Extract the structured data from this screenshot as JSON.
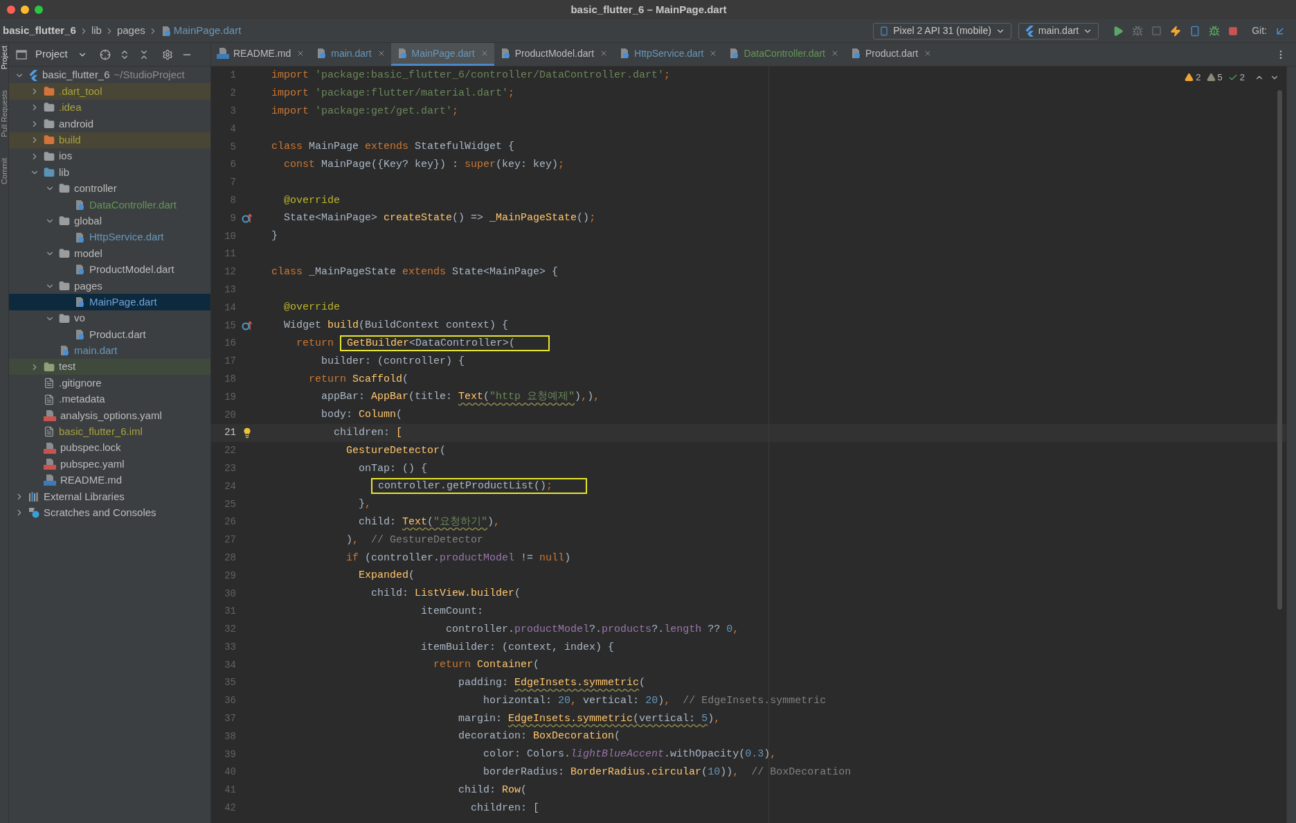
{
  "window": {
    "title": "basic_flutter_6 – MainPage.dart"
  },
  "breadcrumb": [
    "basic_flutter_6",
    "lib",
    "pages",
    "MainPage.dart"
  ],
  "toolbar": {
    "device": "Pixel 2 API 31 (mobile)",
    "run_config": "main.dart",
    "git_label": "Git:"
  },
  "tool_strip": [
    "Project",
    "Pull Requests",
    "Commit"
  ],
  "project_panel": {
    "title": "Project"
  },
  "tree": [
    {
      "name": "basic_flutter_6",
      "note": "~/StudioProject",
      "kind": "flutter",
      "color": "#bbbbbb",
      "expanded": true,
      "children": [
        {
          "name": ".dart_tool",
          "kind": "folder-excluded",
          "color": "#a8a23c",
          "excluded": true,
          "expanded": false
        },
        {
          "name": ".idea",
          "kind": "folder-config",
          "color": "#a8a23c",
          "expanded": false
        },
        {
          "name": "android",
          "kind": "folder-module",
          "color": "#bbbbbb",
          "expanded": false
        },
        {
          "name": "build",
          "kind": "folder-excluded",
          "color": "#a8a23c",
          "excluded": true,
          "expanded": false
        },
        {
          "name": "ios",
          "kind": "folder-module",
          "color": "#bbbbbb",
          "expanded": false
        },
        {
          "name": "lib",
          "kind": "folder-source",
          "color": "#bbbbbb",
          "expanded": true,
          "children": [
            {
              "name": "controller",
              "kind": "folder",
              "color": "#bbbbbb",
              "expanded": true,
              "children": [
                {
                  "name": "DataController.dart",
                  "kind": "dart",
                  "color": "#629755",
                  "selected": false
                }
              ]
            },
            {
              "name": "global",
              "kind": "folder",
              "color": "#bbbbbb",
              "expanded": true,
              "children": [
                {
                  "name": "HttpService.dart",
                  "kind": "dart",
                  "color": "#6897bb",
                  "selected": false
                }
              ]
            },
            {
              "name": "model",
              "kind": "folder",
              "color": "#bbbbbb",
              "expanded": true,
              "children": [
                {
                  "name": "ProductModel.dart",
                  "kind": "dart",
                  "color": "#bbbbbb",
                  "selected": false
                }
              ]
            },
            {
              "name": "pages",
              "kind": "folder",
              "color": "#bbbbbb",
              "expanded": true,
              "children": [
                {
                  "name": "MainPage.dart",
                  "kind": "dart",
                  "selected": true
                }
              ]
            },
            {
              "name": "vo",
              "kind": "folder",
              "color": "#bbbbbb",
              "expanded": true,
              "children": [
                {
                  "name": "Product.dart",
                  "kind": "dart",
                  "color": "#bbbbbb",
                  "selected": false
                }
              ]
            },
            {
              "name": "main.dart",
              "kind": "dart",
              "color": "#6897bb",
              "selected": false
            }
          ]
        },
        {
          "name": "test",
          "kind": "folder-test",
          "color": "#bbbbbb",
          "test_sources": true,
          "expanded": false
        },
        {
          "name": ".gitignore",
          "kind": "file",
          "color": "#bbbbbb"
        },
        {
          "name": ".metadata",
          "kind": "file",
          "color": "#bbbbbb"
        },
        {
          "name": "analysis_options.yaml",
          "kind": "yaml",
          "color": "#bbbbbb"
        },
        {
          "name": "basic_flutter_6.iml",
          "kind": "file",
          "color": "#a8a23c"
        },
        {
          "name": "pubspec.lock",
          "kind": "yaml",
          "color": "#bbbbbb"
        },
        {
          "name": "pubspec.yaml",
          "kind": "yaml",
          "color": "#bbbbbb"
        },
        {
          "name": "README.md",
          "kind": "md",
          "color": "#bbbbbb"
        }
      ]
    },
    {
      "name": "External Libraries",
      "kind": "library",
      "color": "#bbbbbb",
      "expanded": false
    },
    {
      "name": "Scratches and Consoles",
      "kind": "scratches",
      "color": "#bbbbbb",
      "expanded": false
    }
  ],
  "tabs": [
    {
      "label": "README.md",
      "kind": "md",
      "color": "#bbbbbb",
      "selected": false
    },
    {
      "label": "main.dart",
      "kind": "dart",
      "color": "#6897bb",
      "selected": false
    },
    {
      "label": "MainPage.dart",
      "kind": "dart",
      "color": "#6897bb",
      "selected": true
    },
    {
      "label": "ProductModel.dart",
      "kind": "dart",
      "color": "#bbbbbb",
      "selected": false
    },
    {
      "label": "HttpService.dart",
      "kind": "dart",
      "color": "#6897bb",
      "selected": false
    },
    {
      "label": "DataController.dart",
      "kind": "dart",
      "color": "#629755",
      "selected": false
    },
    {
      "label": "Product.dart",
      "kind": "dart",
      "color": "#bbbbbb",
      "selected": false
    }
  ],
  "inspections": [
    {
      "kind": "warning",
      "count": "2"
    },
    {
      "kind": "weak",
      "count": "5"
    },
    {
      "kind": "typo",
      "count": "2"
    }
  ],
  "code_lines": [
    {
      "number": "1",
      "current": false,
      "tokens": [
        {
          "text": "import ",
          "kind": "kw"
        },
        {
          "text": "'package:basic_flutter_6/controller/DataController.dart'",
          "kind": "str"
        },
        {
          "text": ";",
          "kind": "kw"
        }
      ]
    },
    {
      "number": "2",
      "current": false,
      "tokens": [
        {
          "text": "import ",
          "kind": "kw"
        },
        {
          "text": "'package:flutter/material.dart'",
          "kind": "str"
        },
        {
          "text": ";",
          "kind": "kw"
        }
      ]
    },
    {
      "number": "3",
      "current": false,
      "tokens": [
        {
          "text": "import ",
          "kind": "kw"
        },
        {
          "text": "'package:get/get.dart'",
          "kind": "str"
        },
        {
          "text": ";",
          "kind": "kw"
        }
      ]
    },
    {
      "number": "4",
      "current": false
    },
    {
      "number": "5",
      "current": false,
      "tokens": [
        {
          "text": "class ",
          "kind": "kw"
        },
        {
          "text": "MainPage ",
          "kind": "txt"
        },
        {
          "text": "extends ",
          "kind": "kw"
        },
        {
          "text": "StatefulWidget {",
          "kind": "txt"
        }
      ]
    },
    {
      "number": "6",
      "current": false,
      "tokens": [
        {
          "text": "  const ",
          "kind": "kw"
        },
        {
          "text": "MainPage({Key? key}) : ",
          "kind": "txt"
        },
        {
          "text": "super",
          "kind": "kw"
        },
        {
          "text": "(key: key)",
          "kind": "txt"
        },
        {
          "text": ";",
          "kind": "kw"
        }
      ]
    },
    {
      "number": "7",
      "current": false
    },
    {
      "number": "8",
      "current": false,
      "tokens": [
        {
          "text": "  @override",
          "kind": "ann"
        }
      ]
    },
    {
      "number": "9",
      "current": false,
      "kind": "override",
      "tokens": [
        {
          "text": "  State<MainPage> ",
          "kind": "txt"
        },
        {
          "text": "createState",
          "kind": "fn"
        },
        {
          "text": "() => ",
          "kind": "txt"
        },
        {
          "text": "_MainPageState",
          "kind": "fn"
        },
        {
          "text": "()",
          "kind": "txt"
        },
        {
          "text": ";",
          "kind": "kw"
        }
      ]
    },
    {
      "number": "10",
      "current": false,
      "tokens": [
        {
          "text": "}",
          "kind": "txt"
        }
      ]
    },
    {
      "number": "11",
      "current": false
    },
    {
      "number": "12",
      "current": false,
      "tokens": [
        {
          "text": "class ",
          "kind": "kw"
        },
        {
          "text": "_MainPageState ",
          "kind": "txt"
        },
        {
          "text": "extends ",
          "kind": "kw"
        },
        {
          "text": "State<MainPage> {",
          "kind": "txt"
        }
      ]
    },
    {
      "number": "13",
      "current": false
    },
    {
      "number": "14",
      "current": false,
      "tokens": [
        {
          "text": "  @override",
          "kind": "ann"
        }
      ]
    },
    {
      "number": "15",
      "current": false,
      "kind": "override",
      "tokens": [
        {
          "text": "  Widget ",
          "kind": "txt"
        },
        {
          "text": "build",
          "kind": "fn"
        },
        {
          "text": "(BuildContext context) {",
          "kind": "txt"
        }
      ]
    },
    {
      "number": "16",
      "current": false,
      "tokens": [
        {
          "text": "    return ",
          "kind": "kw"
        },
        {
          "text": "GetBuilder",
          "kind": "fn",
          "boxed": true
        },
        {
          "text": "<DataController>(",
          "kind": "txt",
          "boxed": true
        }
      ]
    },
    {
      "number": "17",
      "current": false,
      "tokens": [
        {
          "text": "        builder: (controller) {",
          "kind": "txt"
        }
      ]
    },
    {
      "number": "18",
      "current": false,
      "tokens": [
        {
          "text": "      return ",
          "kind": "kw"
        },
        {
          "text": "Scaffold",
          "kind": "fn"
        },
        {
          "text": "(",
          "kind": "txt"
        }
      ]
    },
    {
      "number": "19",
      "current": false,
      "tokens": [
        {
          "text": "        appBar: ",
          "kind": "txt"
        },
        {
          "text": "AppBar",
          "kind": "fn"
        },
        {
          "text": "(title: ",
          "kind": "txt"
        },
        {
          "text": "Text",
          "kind": "fn",
          "squiggle": true
        },
        {
          "text": "(",
          "kind": "txt",
          "squiggle": true
        },
        {
          "text": "\"http 요청예제\"",
          "kind": "str",
          "squiggle": true
        },
        {
          "text": ")",
          "kind": "txt"
        },
        {
          "text": ",",
          "kind": "kw"
        },
        {
          "text": ")",
          "kind": "txt"
        },
        {
          "text": ",",
          "kind": "kw"
        }
      ]
    },
    {
      "number": "20",
      "current": false,
      "tokens": [
        {
          "text": "        body: ",
          "kind": "txt"
        },
        {
          "text": "Column",
          "kind": "fn"
        },
        {
          "text": "(",
          "kind": "txt"
        }
      ]
    },
    {
      "number": "21",
      "current": true,
      "kind": "bulb",
      "tokens": [
        {
          "text": "          children: ",
          "kind": "txt"
        },
        {
          "text": "[",
          "kind": "fn"
        }
      ]
    },
    {
      "number": "22",
      "current": false,
      "tokens": [
        {
          "text": "            GestureDetector",
          "kind": "fn"
        },
        {
          "text": "(",
          "kind": "txt"
        }
      ]
    },
    {
      "number": "23",
      "current": false,
      "tokens": [
        {
          "text": "              onTap: () {",
          "kind": "txt"
        }
      ]
    },
    {
      "number": "24",
      "current": false,
      "tokens": [
        {
          "text": "                controller.getProductList()",
          "kind": "txt",
          "boxed": true
        },
        {
          "text": ";",
          "kind": "kw",
          "boxed": true
        }
      ]
    },
    {
      "number": "25",
      "current": false,
      "tokens": [
        {
          "text": "              }",
          "kind": "txt"
        },
        {
          "text": ",",
          "kind": "kw"
        }
      ]
    },
    {
      "number": "26",
      "current": false,
      "tokens": [
        {
          "text": "              child: ",
          "kind": "txt"
        },
        {
          "text": "Text",
          "kind": "fn",
          "squiggle": true
        },
        {
          "text": "(",
          "kind": "txt",
          "squiggle": true
        },
        {
          "text": "\"요청하기\"",
          "kind": "str",
          "squiggle": true
        },
        {
          "text": ")",
          "kind": "txt"
        },
        {
          "text": ",",
          "kind": "kw"
        }
      ]
    },
    {
      "number": "27",
      "current": false,
      "tokens": [
        {
          "text": "            )",
          "kind": "txt"
        },
        {
          "text": ",",
          "kind": "kw"
        },
        {
          "text": "  // GestureDetector",
          "kind": "cmt"
        }
      ]
    },
    {
      "number": "28",
      "current": false,
      "tokens": [
        {
          "text": "            if ",
          "kind": "kw"
        },
        {
          "text": "(controller.",
          "kind": "txt"
        },
        {
          "text": "productModel",
          "kind": "field"
        },
        {
          "text": " != ",
          "kind": "txt"
        },
        {
          "text": "null",
          "kind": "kw"
        },
        {
          "text": ")",
          "kind": "txt"
        }
      ]
    },
    {
      "number": "29",
      "current": false,
      "tokens": [
        {
          "text": "              Expanded",
          "kind": "fn"
        },
        {
          "text": "(",
          "kind": "txt"
        }
      ]
    },
    {
      "number": "30",
      "current": false,
      "tokens": [
        {
          "text": "                child: ",
          "kind": "txt"
        },
        {
          "text": "ListView.builder",
          "kind": "fn"
        },
        {
          "text": "(",
          "kind": "txt"
        }
      ]
    },
    {
      "number": "31",
      "current": false,
      "tokens": [
        {
          "text": "                        itemCount:",
          "kind": "txt"
        }
      ]
    },
    {
      "number": "32",
      "current": false,
      "tokens": [
        {
          "text": "                            controller.",
          "kind": "txt"
        },
        {
          "text": "productModel",
          "kind": "field"
        },
        {
          "text": "?.",
          "kind": "txt"
        },
        {
          "text": "products",
          "kind": "field"
        },
        {
          "text": "?.",
          "kind": "txt"
        },
        {
          "text": "length",
          "kind": "field"
        },
        {
          "text": " ?? ",
          "kind": "txt"
        },
        {
          "text": "0",
          "kind": "num"
        },
        {
          "text": ",",
          "kind": "kw"
        }
      ]
    },
    {
      "number": "33",
      "current": false,
      "tokens": [
        {
          "text": "                        itemBuilder: (context, index) {",
          "kind": "txt"
        }
      ]
    },
    {
      "number": "34",
      "current": false,
      "tokens": [
        {
          "text": "                          return ",
          "kind": "kw"
        },
        {
          "text": "Container",
          "kind": "fn"
        },
        {
          "text": "(",
          "kind": "txt"
        }
      ]
    },
    {
      "number": "35",
      "current": false,
      "tokens": [
        {
          "text": "                              padding: ",
          "kind": "txt"
        },
        {
          "text": "EdgeInsets.symmetric",
          "kind": "fn",
          "squiggle": true
        },
        {
          "text": "(",
          "kind": "txt"
        }
      ]
    },
    {
      "number": "36",
      "current": false,
      "tokens": [
        {
          "text": "                                  horizontal: ",
          "kind": "txt"
        },
        {
          "text": "20",
          "kind": "num"
        },
        {
          "text": ",",
          "kind": "kw"
        },
        {
          "text": " vertical: ",
          "kind": "txt"
        },
        {
          "text": "20",
          "kind": "num"
        },
        {
          "text": ")",
          "kind": "txt"
        },
        {
          "text": ",",
          "kind": "kw"
        },
        {
          "text": "  // EdgeInsets.symmetric",
          "kind": "cmt"
        }
      ]
    },
    {
      "number": "37",
      "current": false,
      "tokens": [
        {
          "text": "                              margin: ",
          "kind": "txt"
        },
        {
          "text": "EdgeInsets.symmetric",
          "kind": "fn",
          "squiggle": true
        },
        {
          "text": "(vertical: ",
          "kind": "txt",
          "squiggle": true
        },
        {
          "text": "5",
          "kind": "num",
          "squiggle": true
        },
        {
          "text": ")",
          "kind": "txt"
        },
        {
          "text": ",",
          "kind": "kw"
        }
      ]
    },
    {
      "number": "38",
      "current": false,
      "tokens": [
        {
          "text": "                              decoration: ",
          "kind": "txt"
        },
        {
          "text": "BoxDecoration",
          "kind": "fn"
        },
        {
          "text": "(",
          "kind": "txt"
        }
      ]
    },
    {
      "number": "39",
      "current": false,
      "tokens": [
        {
          "text": "                                  color: Colors.",
          "kind": "txt"
        },
        {
          "text": "lightBlueAccent",
          "kind": "sfield"
        },
        {
          "text": ".withOpacity(",
          "kind": "txt"
        },
        {
          "text": "0.3",
          "kind": "num"
        },
        {
          "text": ")",
          "kind": "txt"
        },
        {
          "text": ",",
          "kind": "kw"
        }
      ]
    },
    {
      "number": "40",
      "current": false,
      "tokens": [
        {
          "text": "                                  borderRadius: ",
          "kind": "txt"
        },
        {
          "text": "BorderRadius.circular",
          "kind": "fn"
        },
        {
          "text": "(",
          "kind": "txt"
        },
        {
          "text": "10",
          "kind": "num"
        },
        {
          "text": "))",
          "kind": "txt"
        },
        {
          "text": ",",
          "kind": "kw"
        },
        {
          "text": "  // BoxDecoration",
          "kind": "cmt"
        }
      ]
    },
    {
      "number": "41",
      "current": false,
      "tokens": [
        {
          "text": "                              child: ",
          "kind": "txt"
        },
        {
          "text": "Row",
          "kind": "fn"
        },
        {
          "text": "(",
          "kind": "txt"
        }
      ]
    },
    {
      "number": "42",
      "current": false,
      "tokens": [
        {
          "text": "                                children: [",
          "kind": "txt"
        }
      ]
    }
  ]
}
